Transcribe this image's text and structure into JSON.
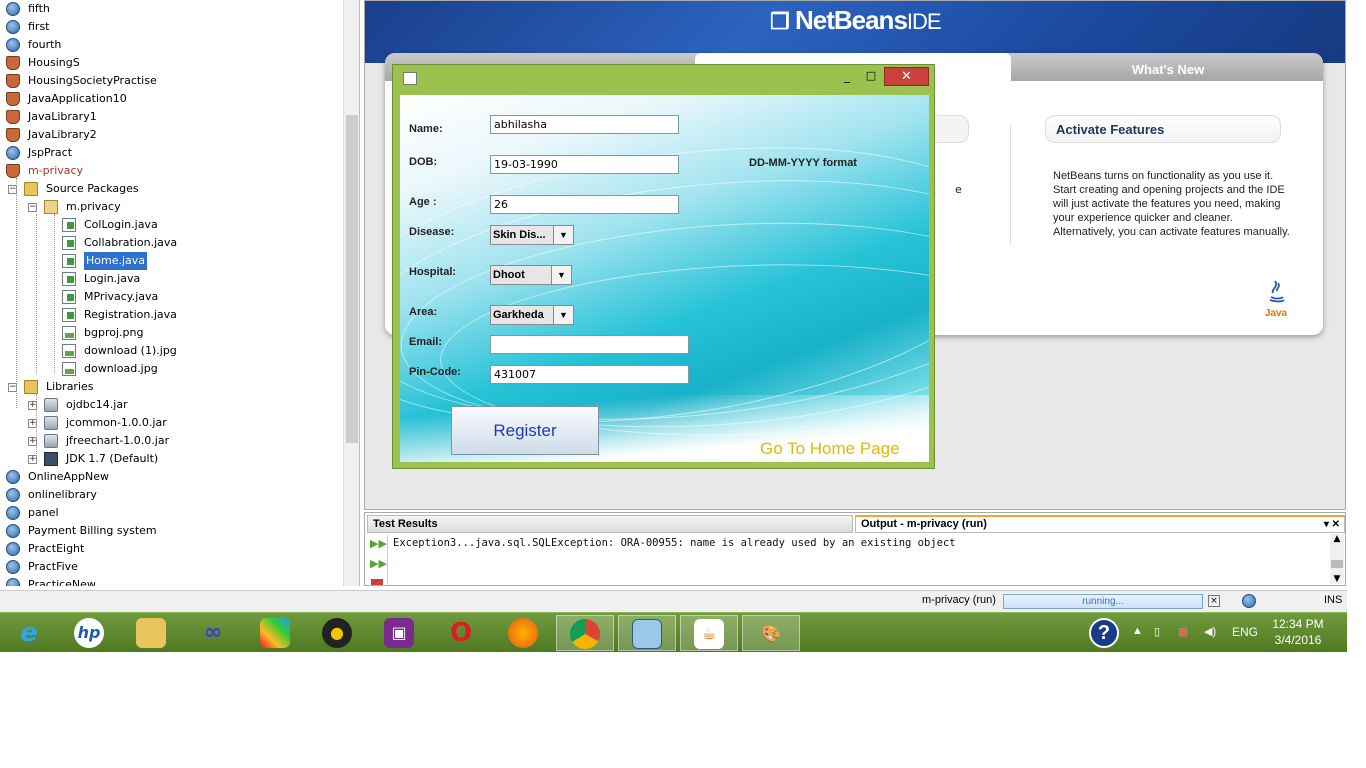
{
  "project_tree": {
    "items": [
      {
        "label": "fifth",
        "icon": "globe-icon",
        "level": 0
      },
      {
        "label": "first",
        "icon": "globe-icon",
        "level": 0
      },
      {
        "label": "fourth",
        "icon": "globe-icon",
        "level": 0
      },
      {
        "label": "HousingS",
        "icon": "coffee-cup-icon",
        "level": 0
      },
      {
        "label": "HousingSocietyPractise",
        "icon": "coffee-cup-icon",
        "level": 0
      },
      {
        "label": "JavaApplication10",
        "icon": "coffee-cup-icon",
        "level": 0
      },
      {
        "label": "JavaLibrary1",
        "icon": "coffee-cup-icon",
        "level": 0
      },
      {
        "label": "JavaLibrary2",
        "icon": "coffee-cup-icon",
        "level": 0
      },
      {
        "label": "JspPract",
        "icon": "globe-icon",
        "level": 0
      },
      {
        "label": "m-privacy",
        "icon": "coffee-cup-icon",
        "level": 0,
        "state": "main-project"
      },
      {
        "label": "Source Packages",
        "icon": "folder-icon",
        "level": 1,
        "expanded": true
      },
      {
        "label": "m.privacy",
        "icon": "package-icon",
        "level": 2,
        "expanded": true
      },
      {
        "label": "ColLogin.java",
        "icon": "java-file-icon",
        "level": 3
      },
      {
        "label": "Collabration.java",
        "icon": "java-file-icon",
        "level": 3
      },
      {
        "label": "Home.java",
        "icon": "java-file-icon",
        "level": 3,
        "state": "selected"
      },
      {
        "label": "Login.java",
        "icon": "java-file-icon",
        "level": 3
      },
      {
        "label": "MPrivacy.java",
        "icon": "java-file-icon",
        "level": 3
      },
      {
        "label": "Registration.java",
        "icon": "java-file-icon",
        "level": 3
      },
      {
        "label": "bgproj.png",
        "icon": "image-file-icon",
        "level": 3
      },
      {
        "label": "download (1).jpg",
        "icon": "image-file-icon",
        "level": 3
      },
      {
        "label": "download.jpg",
        "icon": "image-file-icon",
        "level": 3
      },
      {
        "label": "Libraries",
        "icon": "folder-icon",
        "level": 1,
        "expanded": true
      },
      {
        "label": "ojdbc14.jar",
        "icon": "jar-icon",
        "level": 2
      },
      {
        "label": "jcommon-1.0.0.jar",
        "icon": "jar-icon",
        "level": 2
      },
      {
        "label": "jfreechart-1.0.0.jar",
        "icon": "jar-icon",
        "level": 2
      },
      {
        "label": "JDK 1.7 (Default)",
        "icon": "jdk-icon",
        "level": 2
      },
      {
        "label": "OnlineAppNew",
        "icon": "globe-icon",
        "level": 0
      },
      {
        "label": "onlinelibrary",
        "icon": "globe-icon",
        "level": 0
      },
      {
        "label": "panel",
        "icon": "globe-icon",
        "level": 0
      },
      {
        "label": "Payment Billing system",
        "icon": "globe-icon",
        "level": 0
      },
      {
        "label": "PractEight",
        "icon": "globe-icon",
        "level": 0
      },
      {
        "label": "PractFive",
        "icon": "globe-icon",
        "level": 0
      },
      {
        "label": "PracticeNew",
        "icon": "globe-icon",
        "level": 0
      }
    ]
  },
  "banner": {
    "logo_main": "NetBeans",
    "logo_suffix": "IDE"
  },
  "welcome": {
    "tab_whats_new": "What's New",
    "activate_title": "Activate Features",
    "activate_text": "NetBeans turns on functionality as you use it. Start creating and opening projects and the IDE will just activate the features you need, making your experience quicker and cleaner. Alternatively, you can activate features manually.",
    "partial_char": "e",
    "java_logo": "Java"
  },
  "dialog": {
    "close_glyph": "✕",
    "minimize_glyph": "_",
    "maximize_glyph": "□",
    "labels": {
      "name": "Name:",
      "dob": "DOB:",
      "age": "Age :",
      "disease": "Disease:",
      "hospital": "Hospital:",
      "area": "Area:",
      "email": "Email:",
      "pincode": "Pin-Code:"
    },
    "values": {
      "name": "abhilasha",
      "dob": "19-03-1990",
      "age": "26",
      "disease": "Skin Dis...",
      "hospital": "Dhoot",
      "area": "Garkheda",
      "email": "",
      "pincode": "431007"
    },
    "dob_hint": "DD-MM-YYYY format",
    "register_label": "Register",
    "home_link": "Go To Home Page"
  },
  "bottom": {
    "tab_test_results": "Test Results",
    "tab_output": "Output - m-privacy (run)",
    "output_line": "Exception3...java.sql.SQLException: ORA-00955: name is already used by an existing object"
  },
  "status": {
    "project": "m-privacy (run)",
    "progress": "running...",
    "mode": "INS"
  },
  "taskbar": {
    "apps": [
      "internet-explorer-icon",
      "hp-icon",
      "file-explorer-icon",
      "infinity-icon",
      "puzzle-icon",
      "media-player-icon",
      "remote-icon",
      "opera-icon",
      "firefox-icon",
      "chrome-icon",
      "virtualbox-icon",
      "java-icon",
      "paint-icon"
    ],
    "language": "ENG",
    "time": "12:34 PM",
    "date": "3/4/2016"
  },
  "colors": {
    "dialog_frame": "#9bc24f",
    "selection": "#2f71cd",
    "close_button": "#c9413a",
    "home_link": "#e6b800"
  }
}
